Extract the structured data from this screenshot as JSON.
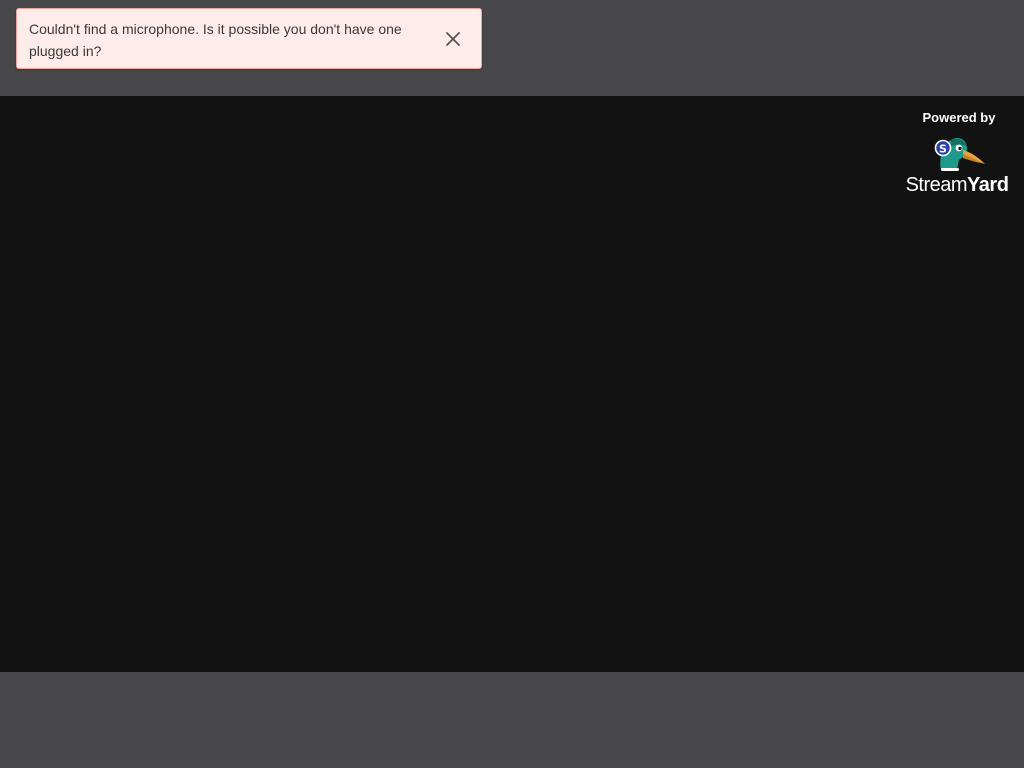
{
  "notification": {
    "message": "Couldn't find a microphone. Is it possible you don't have one plugged in?",
    "close_icon": "close-icon"
  },
  "branding": {
    "powered_by": "Powered by",
    "logo_icon": "duck-logo-icon",
    "name_part_1": "Stream",
    "name_part_2": "Yard"
  },
  "colors": {
    "frame_background": "#48484a",
    "stage_background": "#121212",
    "toast_background": "#fdecea",
    "toast_border": "#f0a49c",
    "brand_teal": "#1f9a8a",
    "brand_beak": "#e8a33c"
  }
}
